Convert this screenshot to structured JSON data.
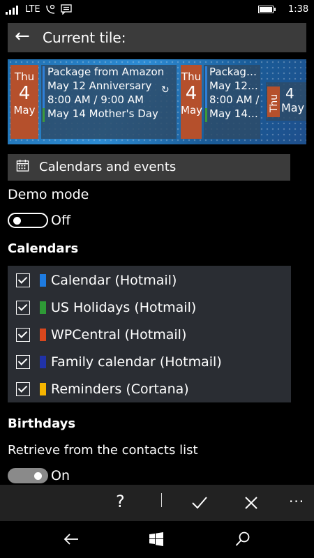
{
  "status": {
    "network": "LTE",
    "time": "1:38"
  },
  "header": {
    "back_icon": "arrow-left-icon",
    "title": "Current tile:"
  },
  "tile": {
    "large": {
      "day": "Thu",
      "date": "4",
      "month": "May",
      "events": [
        "Package from Amazon",
        "May 12 Anniversary",
        "8:00 AM /  9:00 AM",
        "May 14 Mother's Day"
      ]
    },
    "medium": {
      "day": "Thu",
      "date": "4",
      "month": "May",
      "events": [
        "Packag…",
        "May 12…",
        "8:00 AM /",
        "May 14…"
      ]
    },
    "small": {
      "day": "Thu",
      "date": "4",
      "month": "May"
    },
    "colors": {
      "date_block": "#b5502c",
      "event_bar_blue": "#2f7fd6",
      "event_bar_green": "#3c9a3c"
    }
  },
  "section": {
    "icon": "calendar-icon",
    "label": "Calendars and events"
  },
  "demo": {
    "label": "Demo mode",
    "state": "Off"
  },
  "calendars": {
    "heading": "Calendars",
    "items": [
      {
        "name": "Calendar (Hotmail)",
        "color": "#1e7be0",
        "checked": true
      },
      {
        "name": "US Holidays (Hotmail)",
        "color": "#2e9a36",
        "checked": true
      },
      {
        "name": "WPCentral (Hotmail)",
        "color": "#d9471d",
        "checked": true
      },
      {
        "name": "Family calendar (Hotmail)",
        "color": "#2032a8",
        "checked": true
      },
      {
        "name": "Reminders (Cortana)",
        "color": "#f5b400",
        "checked": true
      }
    ]
  },
  "birthdays": {
    "heading": "Birthdays",
    "retrieve_label": "Retrieve from the contacts list",
    "state": "On"
  },
  "appbar": {
    "help": "?",
    "save_icon": "check-icon",
    "cancel_icon": "close-icon",
    "more": "···"
  },
  "navbar": {
    "back_icon": "back-icon",
    "start_icon": "windows-icon",
    "search_icon": "search-icon"
  }
}
